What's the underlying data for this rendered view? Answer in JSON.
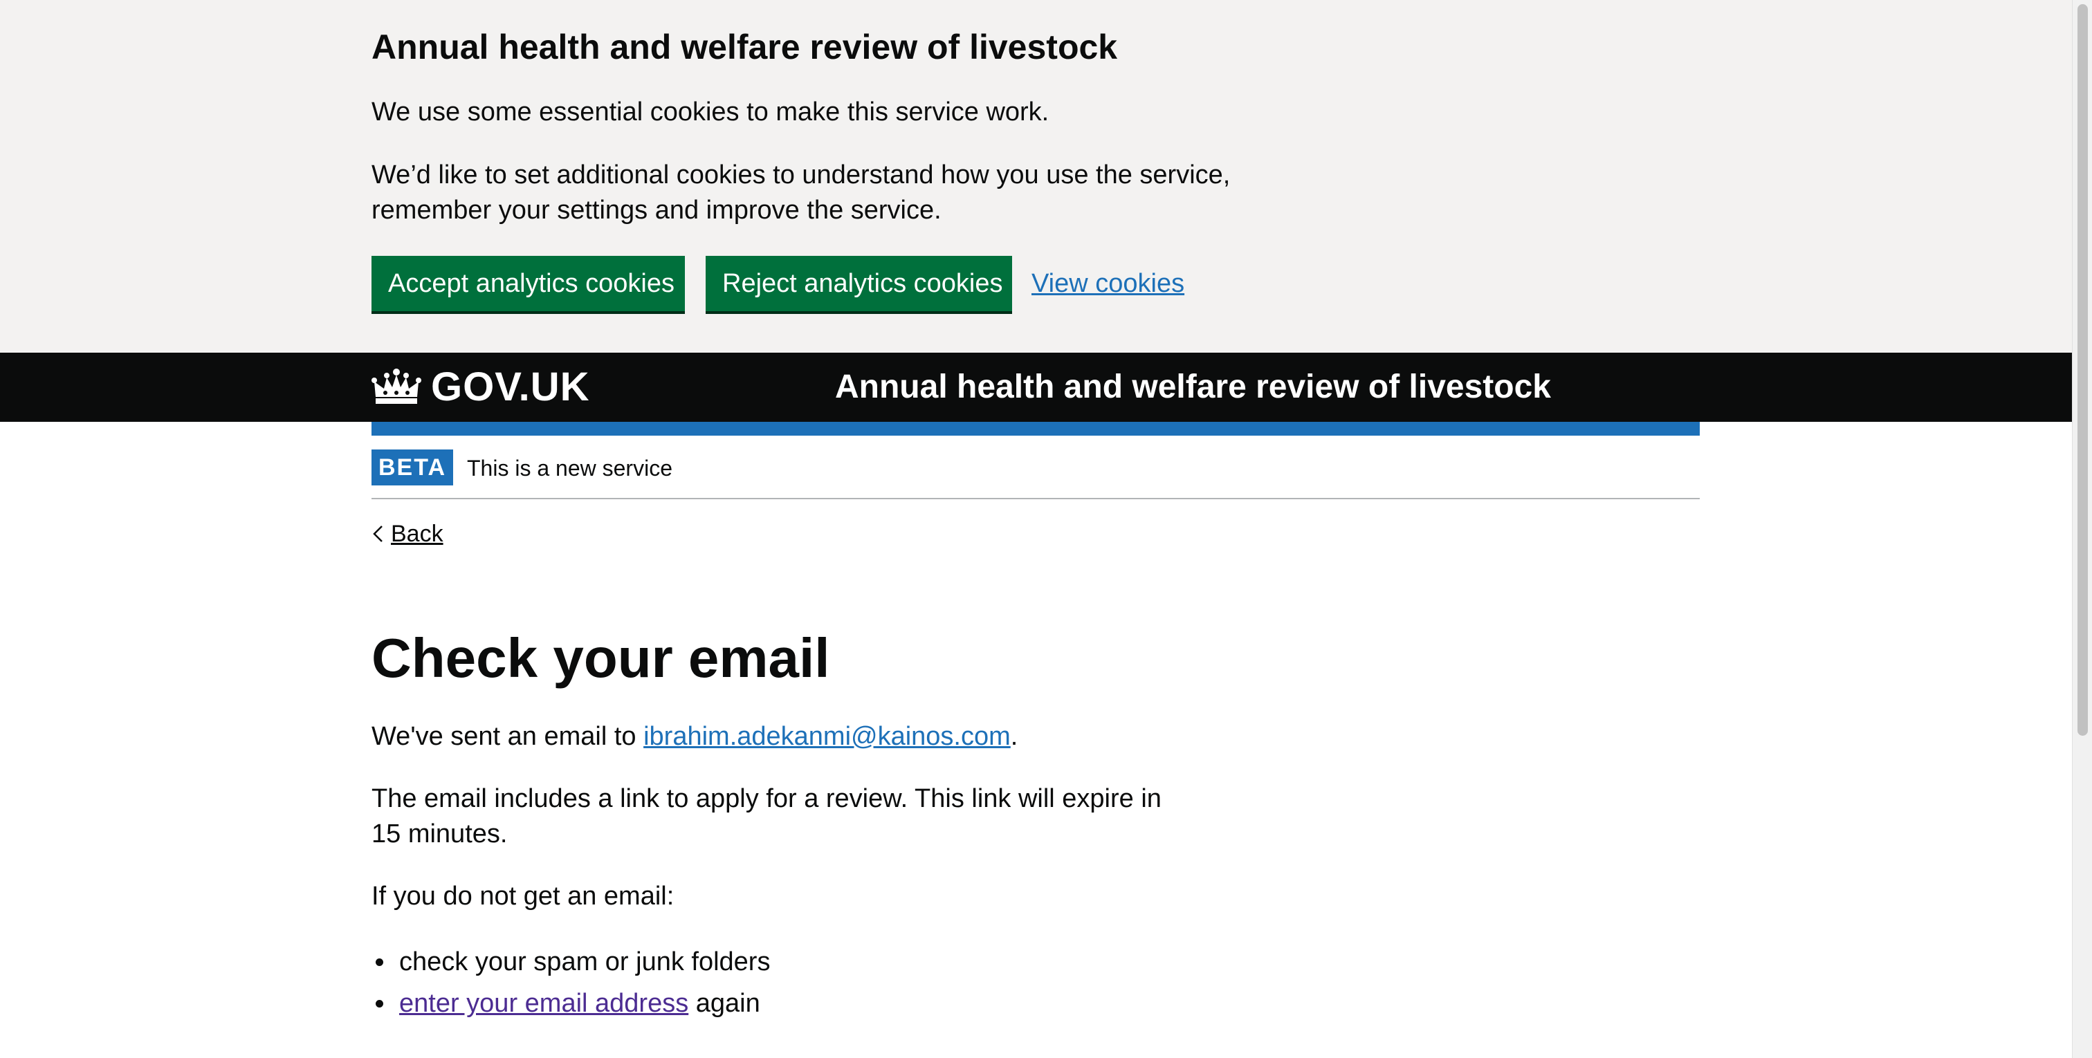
{
  "cookie_banner": {
    "title": "Annual health and welfare review of livestock",
    "paragraph_1": "We use some essential cookies to make this service work.",
    "paragraph_2": "We’d like to set additional cookies to understand how you use the service, remember your settings and improve the service.",
    "accept_label": "Accept analytics cookies",
    "reject_label": "Reject analytics cookies",
    "view_label": "View cookies"
  },
  "header": {
    "logo_icon": "crown-icon",
    "logo_text": "GOV.UK",
    "service_name": "Annual health and welfare review of livestock"
  },
  "phase_banner": {
    "tag": "BETA",
    "text": "This is a new service"
  },
  "back_link": {
    "icon": "chevron-left-icon",
    "label": "Back"
  },
  "main": {
    "title": "Check your email",
    "sent_prefix": "We've sent an email to ",
    "email": "ibrahim.adekanmi@kainos.com",
    "sent_suffix": ".",
    "includes_text": "The email includes a link to apply for a review. This link will expire in 15 minutes.",
    "if_not_text": "If you do not get an email:",
    "bullet_1": "check your spam or junk folders",
    "bullet_2_link": "enter your email address",
    "bullet_2_suffix": " again"
  },
  "colors": {
    "banner_bg": "#f3f2f1",
    "button_green": "#00703c",
    "header_black": "#0b0c0c",
    "brand_blue": "#1d70b8",
    "link_blue": "#1d70b8",
    "visited_link": "#4c2c92"
  }
}
